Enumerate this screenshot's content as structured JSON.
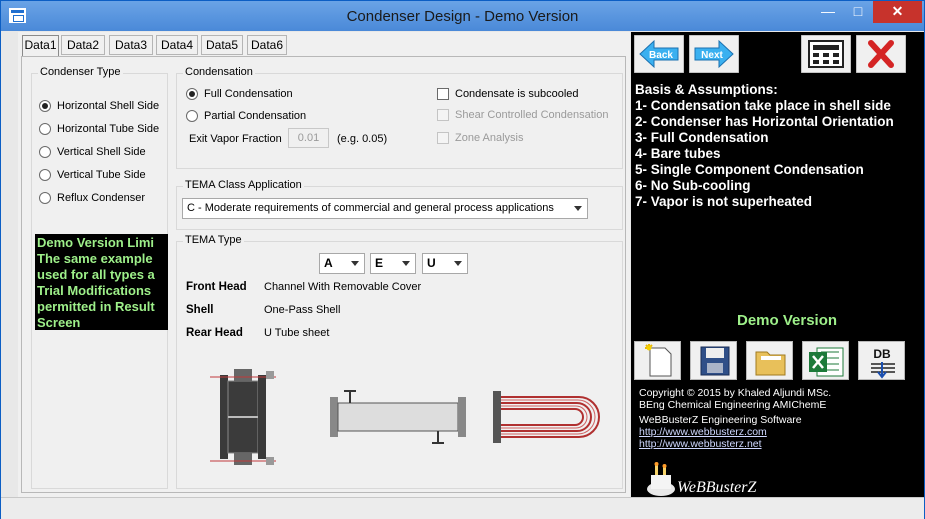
{
  "window": {
    "title": "Condenser Design - Demo Version",
    "min_glyph": "—",
    "max_glyph": "□",
    "close_glyph": "✕"
  },
  "tabs": [
    "Data1",
    "Data2",
    "Data3",
    "Data4",
    "Data5",
    "Data6"
  ],
  "active_tab": "Data1",
  "condenser_type": {
    "title": "Condenser Type",
    "options": [
      "Horizontal Shell Side",
      "Horizontal Tube Side",
      "Vertical Shell Side",
      "Vertical Tube Side",
      "Reflux Condenser"
    ],
    "selected": "Horizontal Shell Side"
  },
  "condensation": {
    "title": "Condensation",
    "full": "Full Condensation",
    "partial": "Partial Condensation",
    "selected": "Full Condensation",
    "exit_vapor_label": "Exit Vapor Fraction",
    "exit_vapor_value": "0.01",
    "exit_vapor_hint": "(e.g. 0.05)",
    "subcooled": "Condensate is subcooled",
    "shear": "Shear Controlled Condensation",
    "zone": "Zone Analysis"
  },
  "tema_class": {
    "title": "TEMA Class Application",
    "value": "C - Moderate requirements of commercial and general process applications"
  },
  "tema_type": {
    "title": "TEMA Type",
    "front_code": "A",
    "shell_code": "E",
    "rear_code": "U",
    "front_label": "Front Head",
    "front_value": "Channel With Removable Cover",
    "shell_label": "Shell",
    "shell_value": "One-Pass Shell",
    "rear_label": "Rear Head",
    "rear_value": "U Tube sheet"
  },
  "demo_box": {
    "lines": [
      "Demo Version Limi",
      "The same example",
      "used for all types a",
      "Trial Modifications",
      "permitted in Result",
      "Screen"
    ]
  },
  "nav": {
    "back": "Back",
    "next": "Next"
  },
  "basis": {
    "title": "Basis & Assumptions:",
    "items": [
      "1- Condensation take place in shell side",
      "2- Condenser has Horizontal Orientation",
      "3- Full Condensation",
      "4- Bare tubes",
      "5- Single Component Condensation",
      "6- No Sub-cooling",
      "7- Vapor is not superheated"
    ]
  },
  "demo_version_label": "Demo Version",
  "toolbar": {
    "db_label": "DB"
  },
  "copyright": {
    "line1": "Copyright © 2015 by Khaled Aljundi MSc.",
    "line2": "BEng Chemical Engineering AMIChemE",
    "line3": "WeBBusterZ Engineering Software",
    "link1": "http://www.webbusterz.com",
    "link2": "http://www.webbusterz.net",
    "logo_text": "WeBBusterZ"
  },
  "colors": {
    "demo_green": "#9ef08a",
    "close_red": "#c7332c",
    "title_blue": "#1f6fd0"
  }
}
